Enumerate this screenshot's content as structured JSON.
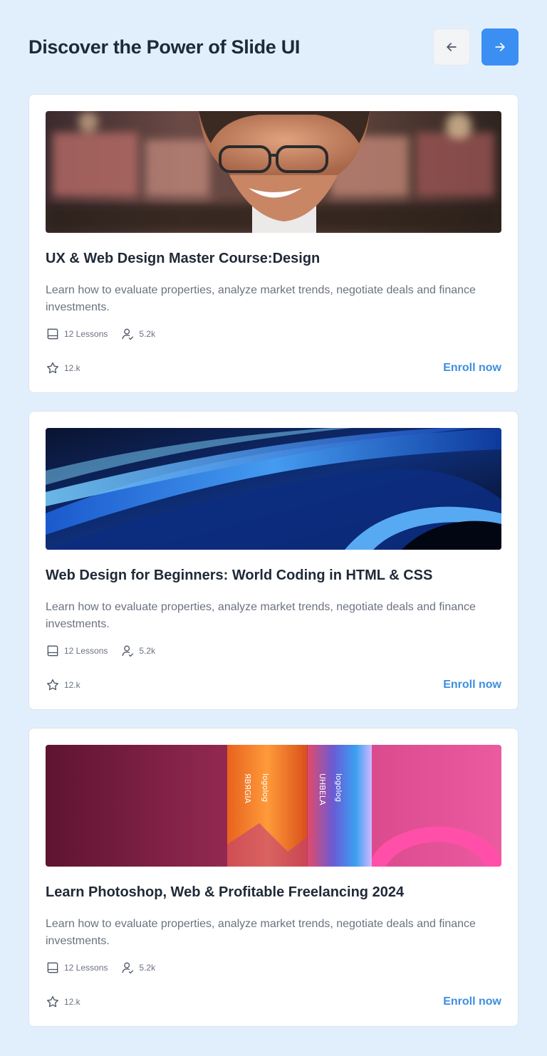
{
  "header": {
    "title": "Discover the Power of Slide UI",
    "prev_icon": "arrow-left-icon",
    "next_icon": "arrow-right-icon"
  },
  "colors": {
    "background": "#e1effd",
    "accent": "#3b8ff3",
    "link": "#3e8ee0"
  },
  "cards": [
    {
      "title": "UX & Web Design Master Course:Design",
      "description": "Learn how to evaluate properties, analyze market trends, negotiate deals and finance investments.",
      "lessons": "12 Lessons",
      "students": "5.2k",
      "rating": "12.k",
      "cta": "Enroll now"
    },
    {
      "title": "Web Design for Beginners: World Coding in HTML & CSS",
      "description": "Learn how to evaluate properties, analyze market trends, negotiate deals and finance investments.",
      "lessons": "12 Lessons",
      "students": "5.2k",
      "rating": "12.k",
      "cta": "Enroll now"
    },
    {
      "title": "Learn Photoshop, Web & Profitable Freelancing 2024",
      "description": "Learn how to evaluate properties, analyze market trends, negotiate deals and finance investments.",
      "lessons": "12 Lessons",
      "students": "5.2k",
      "rating": "12.k",
      "cta": "Enroll now"
    }
  ]
}
